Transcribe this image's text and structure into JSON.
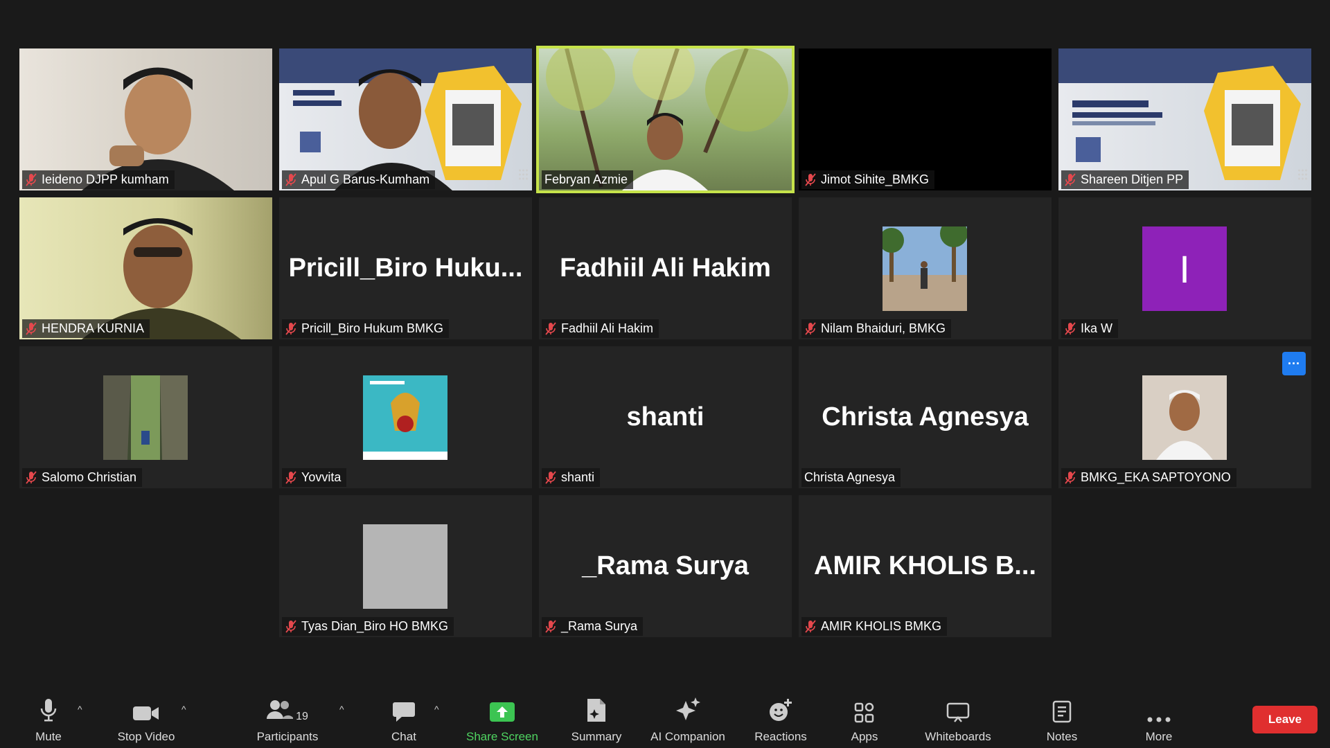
{
  "tiles": [
    {
      "name": "Ieideno DJPP kumham",
      "muted": true,
      "type": "video",
      "variant": "person-light"
    },
    {
      "name": "Apul G Barus-Kumham",
      "muted": true,
      "type": "video",
      "variant": "slide-person"
    },
    {
      "name": "Febryan Azmie",
      "muted": false,
      "type": "video",
      "variant": "tree",
      "active": true
    },
    {
      "name": "Jimot Sihite_BMKG",
      "muted": true,
      "type": "video",
      "variant": "black"
    },
    {
      "name": "Shareen Ditjen PP",
      "muted": true,
      "type": "video",
      "variant": "slide"
    },
    {
      "name": "HENDRA KURNIA",
      "muted": true,
      "type": "video",
      "variant": "person-yellow"
    },
    {
      "name": "Pricill_Biro Hukum BMKG",
      "muted": true,
      "type": "text",
      "center": "Pricill_Biro  Huku..."
    },
    {
      "name": "Fadhiil Ali Hakim",
      "muted": true,
      "type": "text",
      "center": "Fadhiil Ali Hakim"
    },
    {
      "name": "Nilam Bhaiduri, BMKG",
      "muted": true,
      "type": "avatar",
      "variant": "street"
    },
    {
      "name": "Ika W",
      "muted": true,
      "type": "letter",
      "letter": "I",
      "color": "#8e22b8"
    },
    {
      "name": "Salomo Christian",
      "muted": true,
      "type": "avatar",
      "variant": "cave"
    },
    {
      "name": "Yovvita",
      "muted": true,
      "type": "avatar",
      "variant": "emblem"
    },
    {
      "name": "shanti",
      "muted": true,
      "type": "text",
      "center": "shanti"
    },
    {
      "name": "Christa Agnesya",
      "muted": false,
      "type": "text",
      "center": "Christa Agnesya"
    },
    {
      "name": "BMKG_EKA SAPTOYONO",
      "muted": true,
      "type": "avatar",
      "variant": "portrait",
      "menu": true
    },
    {
      "name": "Tyas Dian_Biro HO BMKG",
      "muted": true,
      "type": "avatar",
      "variant": "gray"
    },
    {
      "name": "_Rama Surya",
      "muted": true,
      "type": "text",
      "center": "_Rama Surya"
    },
    {
      "name": "AMIR KHOLIS BMKG",
      "muted": true,
      "type": "text",
      "center": "AMIR  KHOLIS  B..."
    }
  ],
  "toolbar": {
    "mute": "Mute",
    "stop_video": "Stop Video",
    "participants": "Participants",
    "participants_count": "19",
    "chat": "Chat",
    "share_screen": "Share Screen",
    "summary": "Summary",
    "ai_companion": "AI Companion",
    "reactions": "Reactions",
    "apps": "Apps",
    "whiteboards": "Whiteboards",
    "notes": "Notes",
    "more": "More",
    "leave": "Leave"
  },
  "menu_dots": "···",
  "colors": {
    "accent_green": "#4fd461",
    "leave_red": "#e02f2f",
    "active_border": "#c6e34a",
    "mute_red": "#e5484d",
    "menu_blue": "#1f7cf0"
  }
}
